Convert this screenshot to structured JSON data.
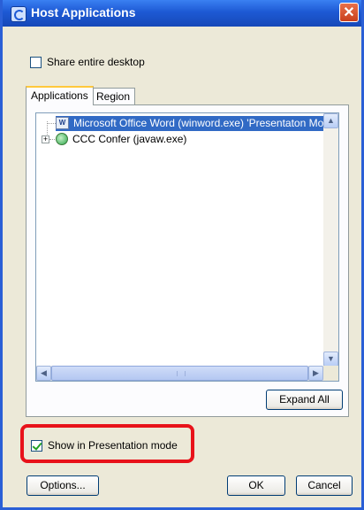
{
  "window": {
    "title": "Host Applications",
    "close_glyph": "✕"
  },
  "share_desktop": {
    "label": "Share entire desktop",
    "checked": false
  },
  "tabs": [
    {
      "label": "Applications",
      "active": true
    },
    {
      "label": "Region",
      "active": false
    }
  ],
  "tree": {
    "items": [
      {
        "label": "Microsoft Office Word (winword.exe) 'Presentaton Moc",
        "icon": "word-icon",
        "selected": true,
        "icon_text": "W"
      },
      {
        "label": "CCC Confer (javaw.exe)",
        "icon": "globe-icon",
        "selected": false,
        "expander": "+"
      }
    ]
  },
  "scroll_glyphs": {
    "up": "▲",
    "down": "▼",
    "left": "◀",
    "right": "▶"
  },
  "buttons": {
    "expand_all": "Expand All",
    "options": "Options...",
    "ok": "OK",
    "cancel": "Cancel"
  },
  "presentation_mode": {
    "label": "Show in Presentation mode",
    "checked": true
  },
  "colors": {
    "highlight": "#e8121a",
    "selection": "#316ac5",
    "titlebar": "#1d59d4"
  }
}
